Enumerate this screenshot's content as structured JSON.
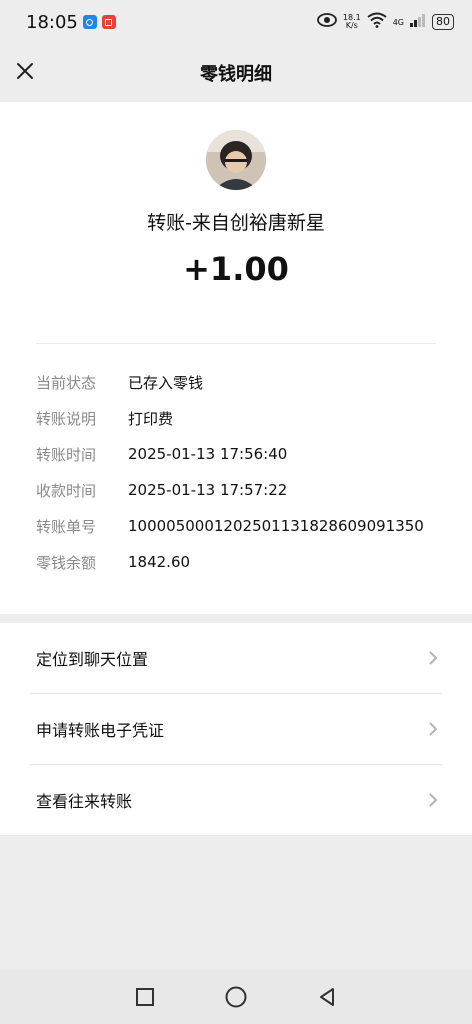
{
  "status_bar": {
    "time": "18:05",
    "speed_value": "18.1",
    "speed_unit": "K/s",
    "network": "4G",
    "battery": "80",
    "icons": [
      "blue-app-icon",
      "red-app-icon",
      "eye-icon",
      "wifi-icon",
      "signal-icon",
      "battery-icon"
    ]
  },
  "nav": {
    "title": "零钱明细",
    "close_icon": "close-icon"
  },
  "transaction": {
    "payer": "转账-来自创裕唐新星",
    "amount": "+1.00"
  },
  "details": [
    {
      "label": "当前状态",
      "value": "已存入零钱"
    },
    {
      "label": "转账说明",
      "value": "打印费"
    },
    {
      "label": "转账时间",
      "value": "2025-01-13 17:56:40"
    },
    {
      "label": "收款时间",
      "value": "2025-01-13 17:57:22"
    },
    {
      "label": "转账单号",
      "value": "1000050001202501131828609091350"
    },
    {
      "label": "零钱余额",
      "value": "1842.60"
    }
  ],
  "actions": [
    {
      "label": "定位到聊天位置"
    },
    {
      "label": "申请转账电子凭证"
    },
    {
      "label": "查看往来转账"
    }
  ],
  "system_nav": [
    "recent-apps-icon",
    "home-icon",
    "back-icon"
  ]
}
